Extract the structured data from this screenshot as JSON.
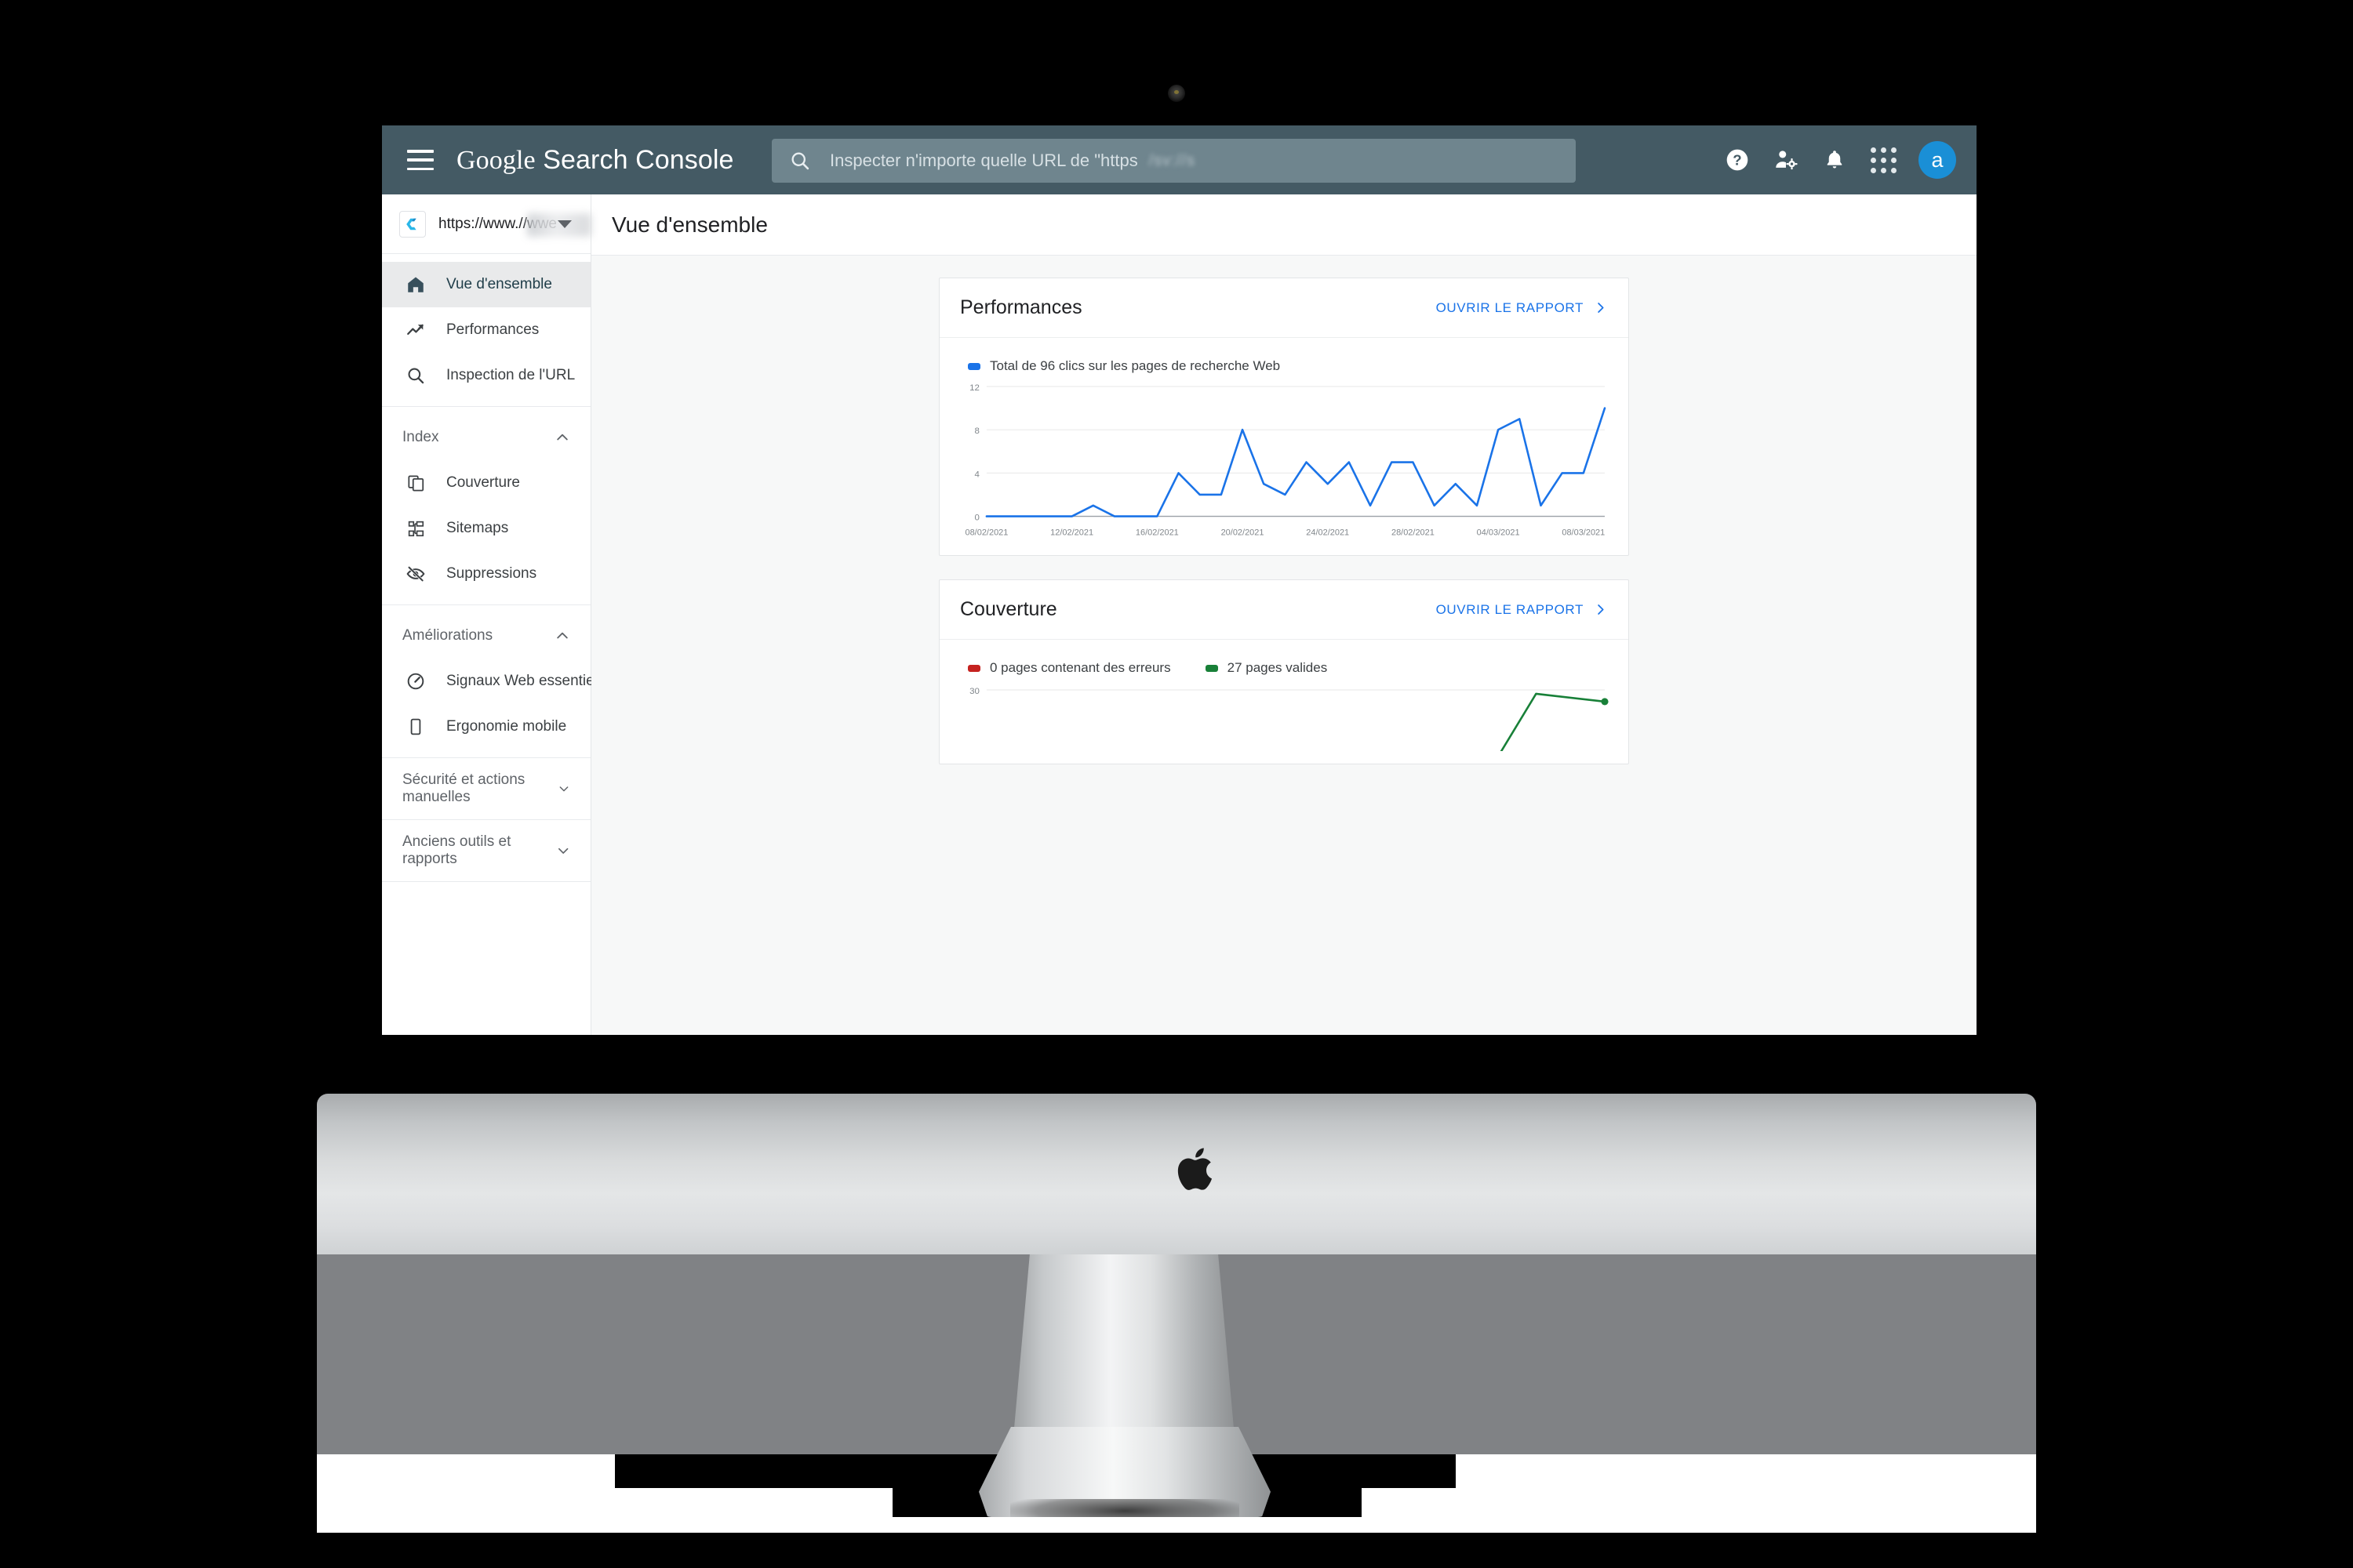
{
  "appbar": {
    "menu_icon": "hamburger-menu-icon",
    "brand_google": "Google",
    "brand_product": "Search Console",
    "search": {
      "icon": "search-icon",
      "placeholder": "Inspecter n'importe quelle URL de \"https",
      "blurred_tail": "/sv://s"
    },
    "actions": [
      {
        "name": "help-icon",
        "label": "?"
      },
      {
        "name": "account-settings-icon",
        "label": ""
      },
      {
        "name": "notifications-bell-icon",
        "label": ""
      },
      {
        "name": "apps-grid-icon",
        "label": ""
      }
    ],
    "avatar_letter": "a"
  },
  "sidebar": {
    "property": {
      "favicon": "property-favicon-c",
      "url": "https://www.//wwe",
      "dropdown_icon": "chevron-down-icon"
    },
    "primary_items": [
      {
        "icon": "home-icon",
        "label": "Vue d'ensemble",
        "active": true
      },
      {
        "icon": "trending-up-icon",
        "label": "Performances",
        "active": false
      },
      {
        "icon": "search-icon",
        "label": "Inspection de l'URL",
        "active": false
      }
    ],
    "index_section": {
      "title": "Index",
      "expand_icon": "chevron-up-icon",
      "items": [
        {
          "icon": "pages-copy-icon",
          "label": "Couverture"
        },
        {
          "icon": "sitemap-icon",
          "label": "Sitemaps"
        },
        {
          "icon": "eye-off-icon",
          "label": "Suppressions"
        }
      ]
    },
    "improvements_section": {
      "title": "Améliorations",
      "expand_icon": "chevron-up-icon",
      "items": [
        {
          "icon": "speedometer-icon",
          "label": "Signaux Web essentiels"
        },
        {
          "icon": "mobile-phone-icon",
          "label": "Ergonomie mobile"
        }
      ]
    },
    "collapsed_sections": [
      {
        "title": "Sécurité et actions manuelles",
        "expand_icon": "chevron-down-icon"
      },
      {
        "title": "Anciens outils et rapports",
        "expand_icon": "chevron-down-icon"
      }
    ]
  },
  "page": {
    "title": "Vue d'ensemble"
  },
  "cards": {
    "performance": {
      "title": "Performances",
      "link_label": "OUVRIR LE RAPPORT",
      "link_icon": "chevron-right-icon",
      "legend_label": "Total de 96 clics sur les pages de recherche Web",
      "legend_color": "#1a73e8"
    },
    "coverage": {
      "title": "Couverture",
      "link_label": "OUVRIR LE RAPPORT",
      "link_icon": "chevron-right-icon",
      "legend": [
        {
          "label": "0 pages contenant des erreurs",
          "color": "#c5221f"
        },
        {
          "label": "27 pages valides",
          "color": "#188038"
        }
      ]
    }
  },
  "hardware": {
    "camera": "webcam-dot",
    "logo": "apple-logo"
  },
  "chart_data": [
    {
      "id": "performance-clicks",
      "type": "line",
      "title": "Total de 96 clics sur les pages de recherche Web",
      "xlabel": "",
      "ylabel": "",
      "ylim": [
        0,
        12
      ],
      "yticks": [
        0,
        4,
        8,
        12
      ],
      "grid": true,
      "legend_position": "top-left",
      "color": "#1a73e8",
      "xtick_labels": [
        "08/02/2021",
        "12/02/2021",
        "16/02/2021",
        "20/02/2021",
        "24/02/2021",
        "28/02/2021",
        "04/03/2021",
        "08/03/2021"
      ],
      "x": [
        "08/02/2021",
        "09/02/2021",
        "10/02/2021",
        "11/02/2021",
        "12/02/2021",
        "13/02/2021",
        "14/02/2021",
        "15/02/2021",
        "16/02/2021",
        "17/02/2021",
        "18/02/2021",
        "19/02/2021",
        "20/02/2021",
        "21/02/2021",
        "22/02/2021",
        "23/02/2021",
        "24/02/2021",
        "25/02/2021",
        "26/02/2021",
        "27/02/2021",
        "28/02/2021",
        "01/03/2021",
        "02/03/2021",
        "03/03/2021",
        "04/03/2021",
        "05/03/2021",
        "06/03/2021",
        "07/03/2021",
        "08/03/2021",
        "09/03/2021"
      ],
      "values": [
        0,
        0,
        0,
        0,
        0,
        1,
        0,
        0,
        0,
        4,
        2,
        2,
        8,
        3,
        2,
        5,
        3,
        5,
        1,
        5,
        5,
        1,
        3,
        1,
        8,
        9,
        1,
        4,
        4,
        10
      ],
      "total": 96
    },
    {
      "id": "coverage-pages",
      "type": "line",
      "title": "Couverture",
      "ylim": [
        0,
        30
      ],
      "yticks": [
        30
      ],
      "grid": true,
      "legend_position": "top-left",
      "series": [
        {
          "name": "0 pages contenant des erreurs",
          "color": "#c5221f",
          "values": [
            0,
            0,
            0,
            0,
            0,
            0,
            0,
            0,
            0,
            0
          ]
        },
        {
          "name": "27 pages valides",
          "color": "#188038",
          "values": [
            0,
            0,
            0,
            0,
            0,
            0,
            0,
            0,
            29,
            27
          ]
        }
      ]
    }
  ]
}
